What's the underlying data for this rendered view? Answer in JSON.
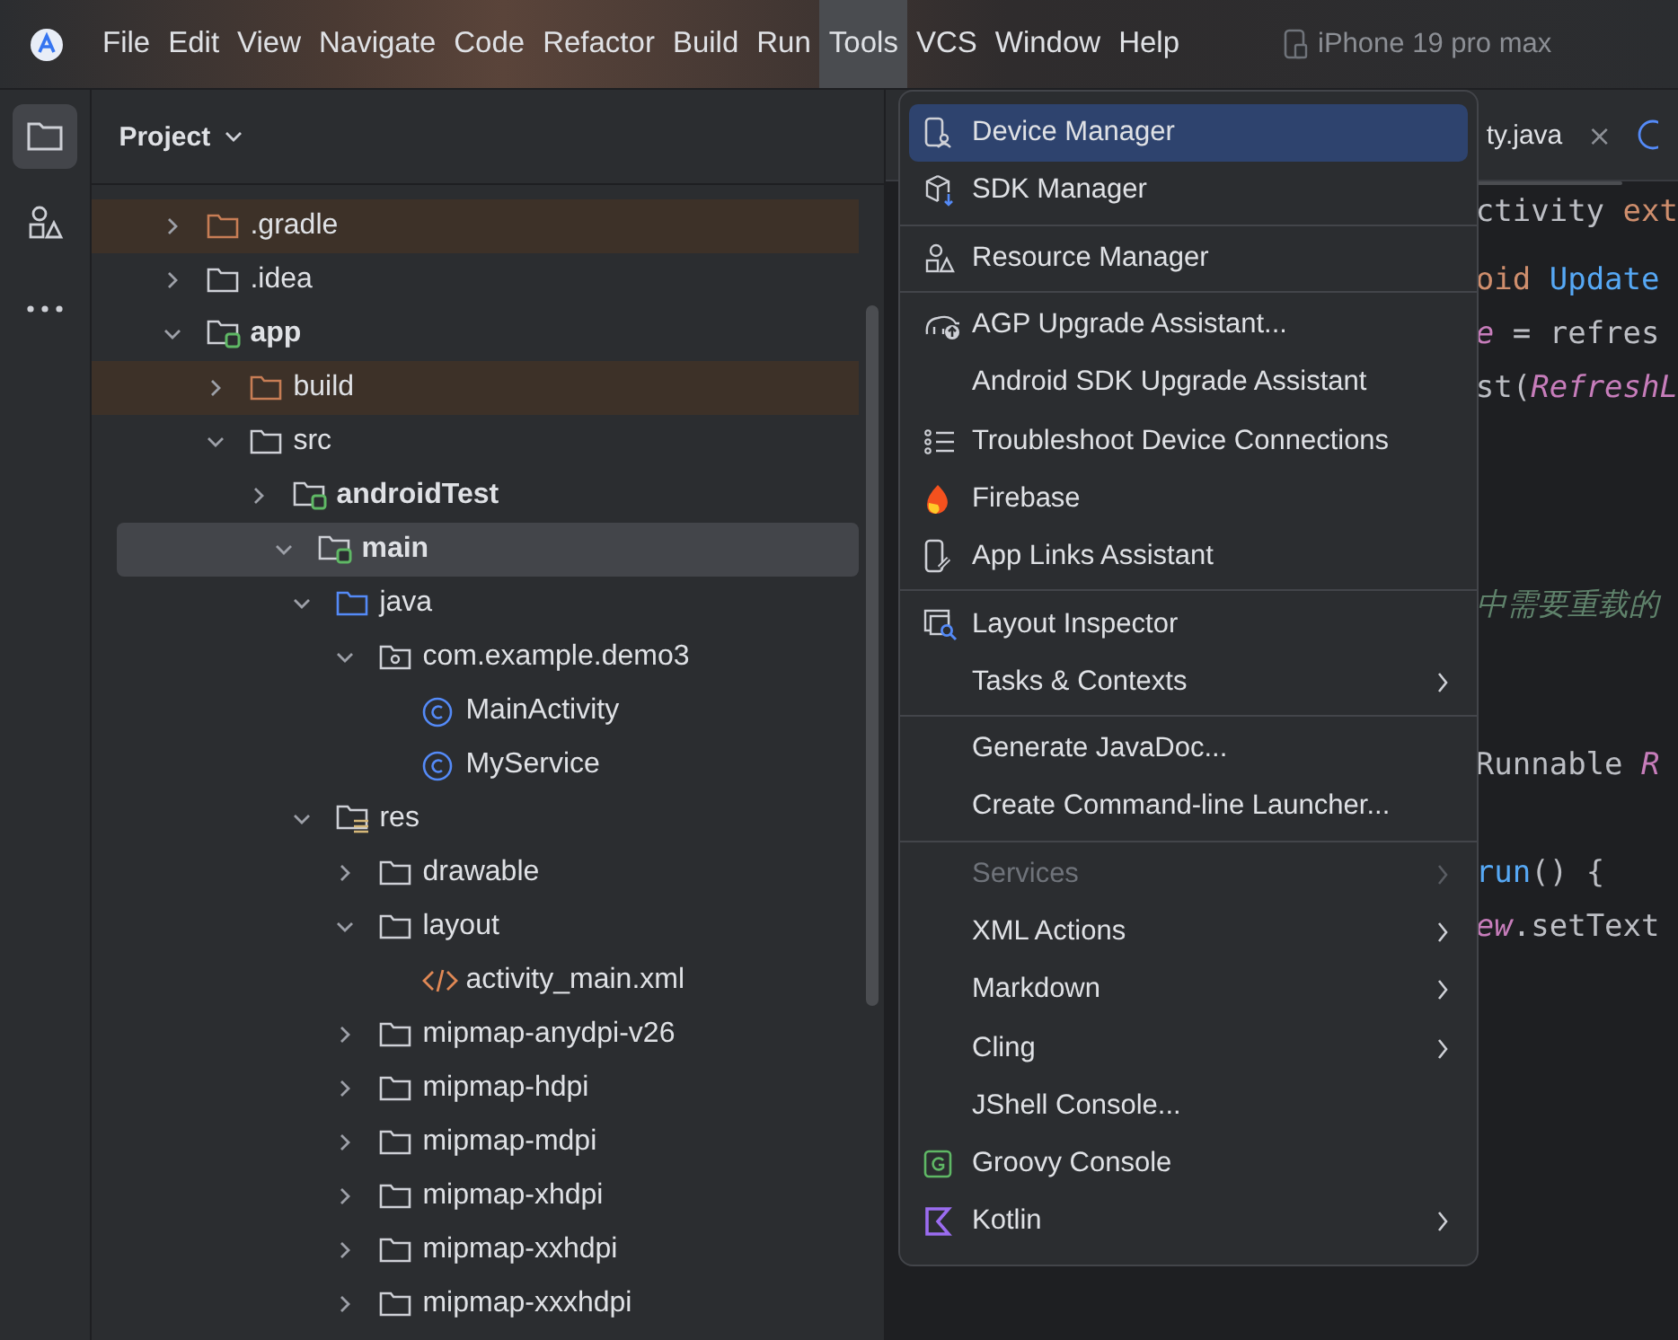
{
  "menubar": {
    "items": [
      {
        "label": "File",
        "selected": false
      },
      {
        "label": "Edit",
        "selected": false
      },
      {
        "label": "View",
        "selected": false
      },
      {
        "label": "Navigate",
        "selected": false
      },
      {
        "label": "Code",
        "selected": false
      },
      {
        "label": "Refactor",
        "selected": false
      },
      {
        "label": "Build",
        "selected": false
      },
      {
        "label": "Run",
        "selected": false
      },
      {
        "label": "Tools",
        "selected": true
      },
      {
        "label": "VCS",
        "selected": false
      },
      {
        "label": "Window",
        "selected": false
      },
      {
        "label": "Help",
        "selected": false
      }
    ],
    "device": "iPhone 19 pro max"
  },
  "toolstrip": [
    {
      "kind": "folder",
      "selected": true
    },
    {
      "kind": "shapes",
      "selected": false
    },
    {
      "kind": "more",
      "selected": false
    }
  ],
  "project": {
    "title": "Project",
    "tree": [
      {
        "label": ".gradle",
        "kind": "excluded",
        "expanded": false,
        "highlighted": true,
        "selected": false
      },
      {
        "label": ".idea",
        "kind": "folder",
        "expanded": false,
        "highlighted": false,
        "selected": false
      },
      {
        "label": "app",
        "kind": "module",
        "expanded": true,
        "highlighted": false,
        "selected": false,
        "children": [
          {
            "label": "build",
            "kind": "excluded",
            "expanded": false,
            "highlighted": true,
            "selected": false
          },
          {
            "label": "src",
            "kind": "folder",
            "expanded": true,
            "highlighted": false,
            "selected": false,
            "children": [
              {
                "label": "androidTest",
                "kind": "module",
                "expanded": false,
                "highlighted": false,
                "selected": false
              },
              {
                "label": "main",
                "kind": "module",
                "expanded": true,
                "highlighted": false,
                "selected": true,
                "children": [
                  {
                    "label": "java",
                    "kind": "source",
                    "expanded": true,
                    "highlighted": false,
                    "selected": false,
                    "children": [
                      {
                        "label": "com.example.demo3",
                        "kind": "package",
                        "expanded": true,
                        "highlighted": false,
                        "selected": false,
                        "children": [
                          {
                            "label": "MainActivity",
                            "kind": "class",
                            "highlighted": false,
                            "selected": false
                          },
                          {
                            "label": "MyService",
                            "kind": "class",
                            "highlighted": false,
                            "selected": false
                          }
                        ]
                      }
                    ]
                  },
                  {
                    "label": "res",
                    "kind": "resources",
                    "expanded": true,
                    "highlighted": false,
                    "selected": false,
                    "children": [
                      {
                        "label": "drawable",
                        "kind": "folder",
                        "expanded": false,
                        "highlighted": false,
                        "selected": false
                      },
                      {
                        "label": "layout",
                        "kind": "folder",
                        "expanded": true,
                        "highlighted": false,
                        "selected": false,
                        "children": [
                          {
                            "label": "activity_main.xml",
                            "kind": "xml",
                            "highlighted": false,
                            "selected": false
                          }
                        ]
                      },
                      {
                        "label": "mipmap-anydpi-v26",
                        "kind": "folder",
                        "expanded": false,
                        "highlighted": false,
                        "selected": false
                      },
                      {
                        "label": "mipmap-hdpi",
                        "kind": "folder",
                        "expanded": false,
                        "highlighted": false,
                        "selected": false
                      },
                      {
                        "label": "mipmap-mdpi",
                        "kind": "folder",
                        "expanded": false,
                        "highlighted": false,
                        "selected": false
                      },
                      {
                        "label": "mipmap-xhdpi",
                        "kind": "folder",
                        "expanded": false,
                        "highlighted": false,
                        "selected": false
                      },
                      {
                        "label": "mipmap-xxhdpi",
                        "kind": "folder",
                        "expanded": false,
                        "highlighted": false,
                        "selected": false
                      },
                      {
                        "label": "mipmap-xxxhdpi",
                        "kind": "folder",
                        "expanded": false,
                        "highlighted": false,
                        "selected": false
                      }
                    ]
                  }
                ]
              }
            ]
          }
        ]
      }
    ]
  },
  "editor": {
    "tab": {
      "label": "ty.java",
      "close": "×"
    },
    "lines": [
      {
        "parts": [
          {
            "text": "ctivity ",
            "kind": "plain"
          },
          {
            "text": "ext",
            "kind": "keyword"
          }
        ]
      },
      {
        "parts": [
          {
            "text": "oid ",
            "kind": "keyword"
          },
          {
            "text": "Update",
            "kind": "method"
          }
        ]
      },
      {
        "parts": [
          {
            "text": "e",
            "kind": "field"
          },
          {
            "text": " = refres",
            "kind": "plain"
          }
        ]
      },
      {
        "parts": [
          {
            "text": "st(",
            "kind": "plain"
          },
          {
            "text": "RefreshL",
            "kind": "italic"
          }
        ]
      },
      {
        "parts": [
          {
            "text": "中需要重载的",
            "kind": "comment"
          }
        ]
      },
      {
        "parts": [
          {
            "text": "Runnable ",
            "kind": "plain"
          },
          {
            "text": "R",
            "kind": "italic"
          }
        ]
      },
      {
        "parts": [
          {
            "text": "run",
            "kind": "method"
          },
          {
            "text": "() {",
            "kind": "plain"
          }
        ]
      },
      {
        "parts": [
          {
            "text": "ew",
            "kind": "field"
          },
          {
            "text": ".setText",
            "kind": "plain"
          }
        ]
      }
    ]
  },
  "tools_menu": {
    "groups": [
      [
        {
          "label": "Device Manager",
          "submenu": false,
          "disabled": false,
          "selected": true
        },
        {
          "label": "SDK Manager",
          "submenu": false,
          "disabled": false,
          "selected": false
        }
      ],
      [
        {
          "label": "Resource Manager",
          "submenu": false,
          "disabled": false,
          "selected": false
        }
      ],
      [
        {
          "label": "AGP Upgrade Assistant...",
          "submenu": false,
          "disabled": false,
          "selected": false
        },
        {
          "label": "Android SDK Upgrade Assistant",
          "submenu": false,
          "disabled": false,
          "selected": false
        },
        {
          "label": "Troubleshoot Device Connections",
          "submenu": false,
          "disabled": false,
          "selected": false
        },
        {
          "label": "Firebase",
          "submenu": false,
          "disabled": false,
          "selected": false
        },
        {
          "label": "App Links Assistant",
          "submenu": false,
          "disabled": false,
          "selected": false
        }
      ],
      [
        {
          "label": "Layout Inspector",
          "submenu": false,
          "disabled": false,
          "selected": false
        },
        {
          "label": "Tasks & Contexts",
          "submenu": true,
          "disabled": false,
          "selected": false
        }
      ],
      [
        {
          "label": "Generate JavaDoc...",
          "submenu": false,
          "disabled": false,
          "selected": false
        },
        {
          "label": "Create Command-line Launcher...",
          "submenu": false,
          "disabled": false,
          "selected": false
        }
      ],
      [
        {
          "label": "Services",
          "submenu": true,
          "disabled": true,
          "selected": false
        },
        {
          "label": "XML Actions",
          "submenu": true,
          "disabled": false,
          "selected": false
        },
        {
          "label": "Markdown",
          "submenu": true,
          "disabled": false,
          "selected": false
        },
        {
          "label": "Cling",
          "submenu": true,
          "disabled": false,
          "selected": false
        },
        {
          "label": "JShell Console...",
          "submenu": false,
          "disabled": false,
          "selected": false
        },
        {
          "label": "Groovy Console",
          "submenu": false,
          "disabled": false,
          "selected": false
        },
        {
          "label": "Kotlin",
          "submenu": true,
          "disabled": false,
          "selected": false
        }
      ]
    ]
  }
}
